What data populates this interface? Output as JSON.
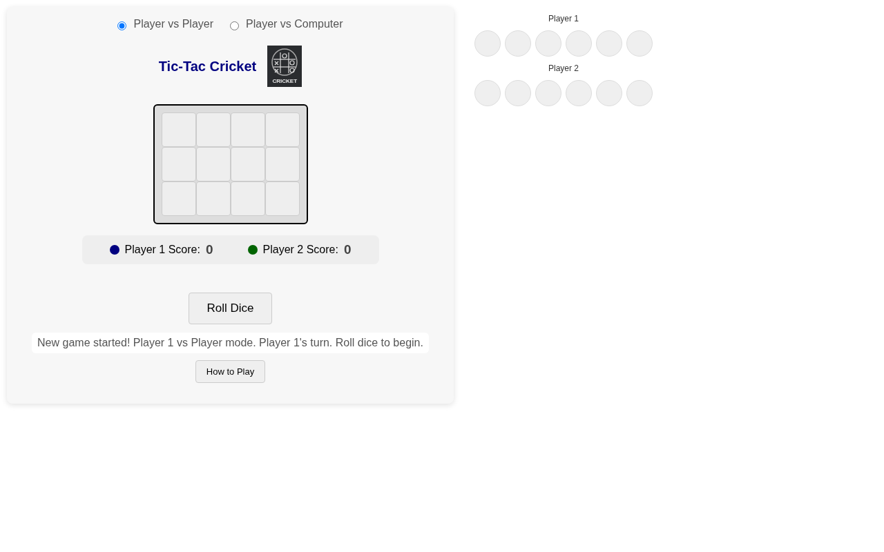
{
  "modes": [
    {
      "label": "Player vs Player",
      "selected": true
    },
    {
      "label": "Player vs Computer",
      "selected": false
    }
  ],
  "title": "Tic-Tac Cricket",
  "logo": {
    "caption": "CRICKET"
  },
  "board": [
    [
      {
        "kind": "empty"
      },
      {
        "kind": "empty"
      },
      {
        "kind": "empty"
      },
      {
        "kind": "empty"
      }
    ],
    [
      {
        "kind": "empty"
      },
      {
        "kind": "empty"
      },
      {
        "kind": "empty"
      },
      {
        "kind": "empty"
      }
    ],
    [
      {
        "kind": "empty"
      },
      {
        "kind": "empty"
      },
      {
        "kind": "empty"
      },
      {
        "kind": "empty"
      }
    ]
  ],
  "scores": [
    {
      "label": "Player 1 Score:",
      "value": "0",
      "color": "#000080"
    },
    {
      "label": "Player 2 Score:",
      "value": "0",
      "color": "#006400"
    }
  ],
  "roll_button": "Roll Dice",
  "message": "New game started! Player 1 vs Player mode. Player 1's turn. Roll dice to begin.",
  "help_button": "How to Play",
  "dice_tracks": [
    {
      "label": "Player 1",
      "slots": [
        {
          "kind": "empty"
        },
        {
          "kind": "empty"
        },
        {
          "kind": "empty"
        },
        {
          "kind": "empty"
        },
        {
          "kind": "empty"
        },
        {
          "kind": "empty"
        }
      ]
    },
    {
      "label": "Player 2",
      "slots": [
        {
          "kind": "empty"
        },
        {
          "kind": "empty"
        },
        {
          "kind": "empty"
        },
        {
          "kind": "empty"
        },
        {
          "kind": "empty"
        },
        {
          "kind": "empty"
        }
      ]
    }
  ]
}
